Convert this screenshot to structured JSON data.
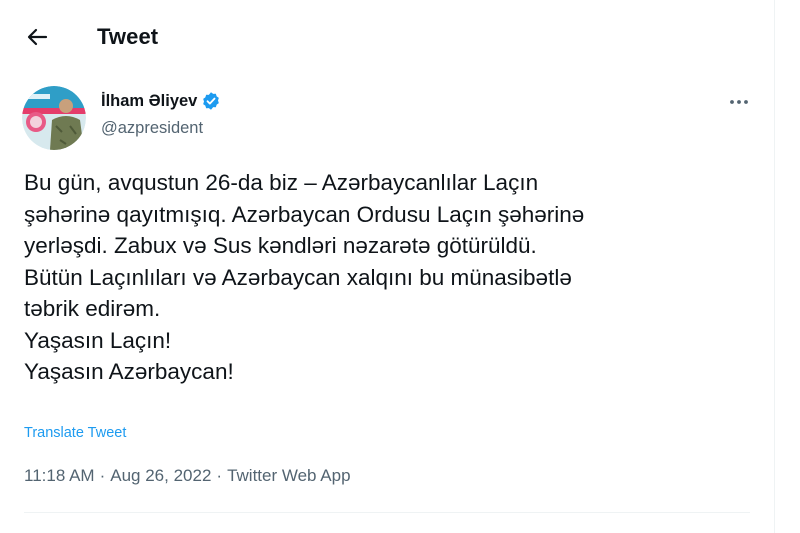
{
  "header": {
    "title": "Tweet",
    "back_icon": "arrow-left-icon"
  },
  "author": {
    "name": "İlham Əliyev",
    "handle": "@azpresident",
    "verified": true,
    "verified_color": "#1d9bf0",
    "avatar_icon": "profile-avatar"
  },
  "more_icon": "more-options-icon",
  "tweet": {
    "lines": [
      "Bu gün, avqustun 26-da biz – Azərbaycanlılar Laçın",
      "şəhərinə qayıtmışıq. Azərbaycan Ordusu Laçın şəhərinə",
      "yerləşdi. Zabux və Sus kəndləri nəzarətə götürüldü.",
      "Bütün Laçınlıları və Azərbaycan xalqını bu münasibətlə",
      "təbrik edirəm.",
      "Yaşasın Laçın!",
      "Yaşasın Azərbaycan!"
    ],
    "translate_label": "Translate Tweet"
  },
  "meta": {
    "time": "11:18 AM",
    "date": "Aug 26, 2022",
    "source": "Twitter Web App",
    "separator": "·"
  },
  "colors": {
    "accent": "#1d9bf0",
    "text": "#0f1419",
    "secondary": "#536471"
  }
}
